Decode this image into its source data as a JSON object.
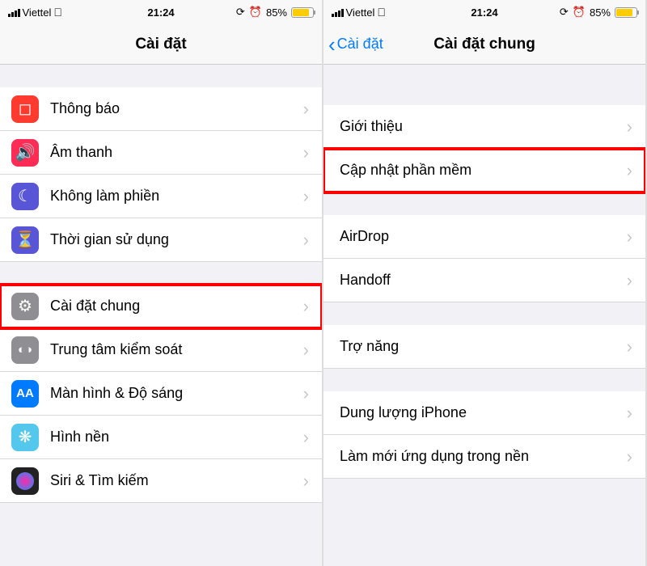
{
  "status": {
    "carrier": "Viettel",
    "time": "21:24",
    "battery_text": "85%",
    "battery_pct": 85
  },
  "left": {
    "title": "Cài đặt",
    "rows": {
      "notif": "Thông báo",
      "sound": "Âm thanh",
      "dnd": "Không làm phiền",
      "screentime": "Thời gian sử dụng",
      "general": "Cài đặt chung",
      "control": "Trung tâm kiểm soát",
      "display": "Màn hình & Độ sáng",
      "wallpaper": "Hình nền",
      "siri": "Siri & Tìm kiếm"
    }
  },
  "right": {
    "back": "Cài đặt",
    "title": "Cài đặt chung",
    "rows": {
      "about": "Giới thiệu",
      "update": "Cập nhật phần mềm",
      "airdrop": "AirDrop",
      "handoff": "Handoff",
      "accessibility": "Trợ năng",
      "storage": "Dung lượng iPhone",
      "bgrefresh": "Làm mới ứng dụng trong nền"
    }
  }
}
